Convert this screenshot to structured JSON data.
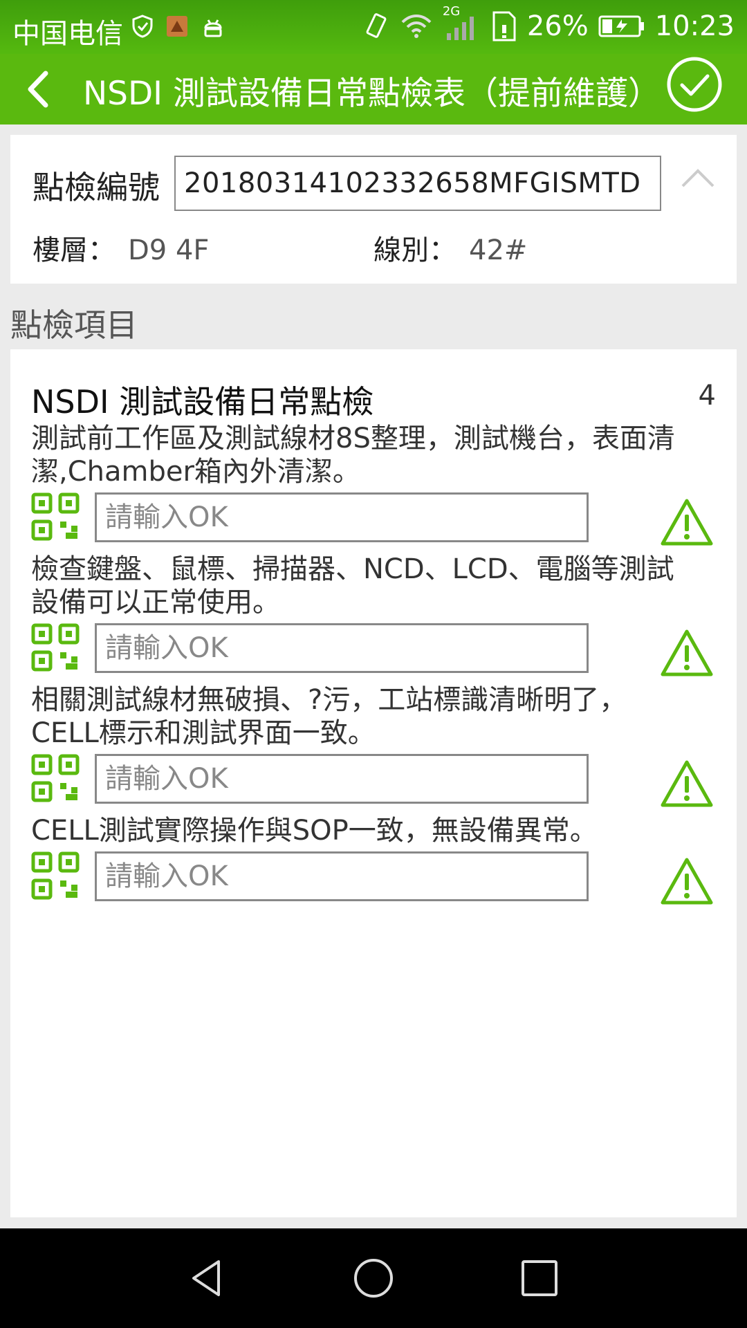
{
  "status_bar": {
    "carrier": "中国电信",
    "network": "2G",
    "battery": "26%",
    "time": "10:23"
  },
  "app_bar": {
    "title": "NSDI 測試設備日常點檢表（提前維護）"
  },
  "header": {
    "id_label": "點檢編號",
    "id_value": "20180314102332658MFGISMTD",
    "floor_label": "樓層：",
    "floor_value": "D9 4F",
    "line_label": "線別：",
    "line_value": "42#"
  },
  "section": {
    "title": "點檢項目"
  },
  "group": {
    "title": "NSDI 測試設備日常點檢",
    "count": "4",
    "items": [
      {
        "desc_line1": "測試前工作區及測試線材8S整理，測試機台，表面清",
        "desc_line2": "潔,Chamber箱內外清潔。",
        "placeholder": "請輸入OK"
      },
      {
        "desc_line1": "檢查鍵盤、鼠標、掃描器、NCD、LCD、電腦等測試",
        "desc_line2": "設備可以正常使用。",
        "placeholder": "請輸入OK"
      },
      {
        "desc_line1": "相關測試線材無破損、?污，工站標識清晰明了，",
        "desc_line2": "CELL標示和測試界面一致。",
        "placeholder": "請輸入OK"
      },
      {
        "desc_line1": "CELL測試實際操作與SOP一致，無設備異常。",
        "desc_line2": "",
        "placeholder": "請輸入OK"
      }
    ]
  },
  "icons": {
    "qr": "qr-code-icon",
    "warning": "warning-icon",
    "back": "back-arrow-icon",
    "confirm": "check-circle-icon"
  },
  "colors": {
    "accent": "#5ab90f",
    "status_bar": "#4aa80c"
  }
}
